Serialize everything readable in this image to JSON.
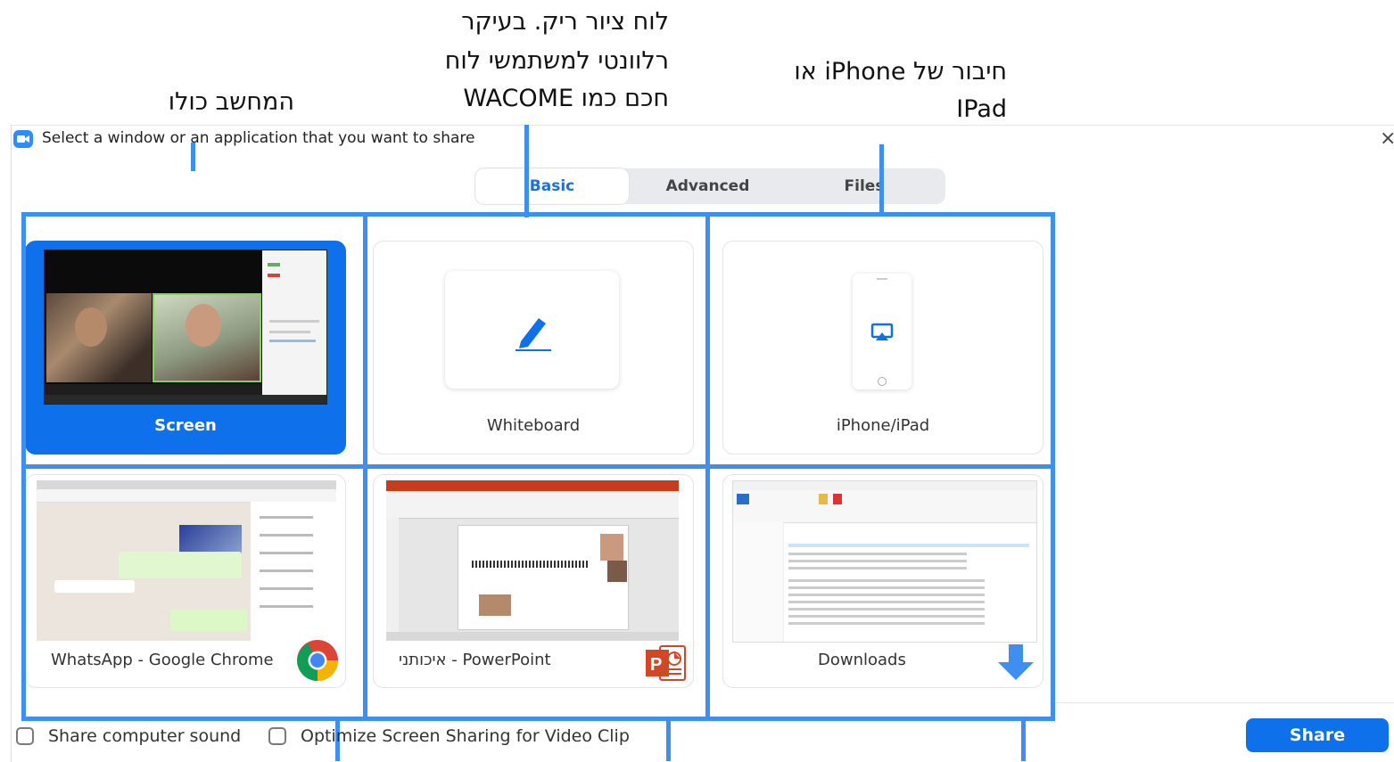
{
  "annotations": {
    "whole_computer": "המחשב כולו",
    "whiteboard_note_1": "לוח ציור ריק. בעיקר",
    "whiteboard_note_2": "רלוונטי למשתמשי לוח",
    "whiteboard_note_3": "חכם כמו WACOME",
    "iphone_note_1": "חיבור של iPhone או",
    "iphone_note_2": "IPad"
  },
  "window": {
    "title": "Select a window or an application that you want to share",
    "close_glyph": "×"
  },
  "tabs": [
    {
      "label": "Basic",
      "active": true
    },
    {
      "label": "Advanced",
      "active": false
    },
    {
      "label": "Files",
      "active": false
    }
  ],
  "cards": {
    "screen": "Screen",
    "whiteboard": "Whiteboard",
    "iphone": "iPhone/iPad",
    "whatsapp": "WhatsApp - Google Chrome",
    "powerpoint": "איכותני - PowerPoint",
    "downloads": "Downloads"
  },
  "footer": {
    "share_sound": "Share computer sound",
    "optimize_video": "Optimize Screen Sharing for Video Clip",
    "share_button": "Share"
  },
  "icons": {
    "zoom": "zoom-icon",
    "pen": "pen-icon",
    "airplay": "airplay-icon",
    "chrome": "chrome-icon",
    "powerpoint": "powerpoint-icon",
    "download": "download-arrow-icon"
  },
  "colors": {
    "accent": "#0e71eb",
    "guide": "#3f8ff0",
    "ppt": "#d24726"
  }
}
